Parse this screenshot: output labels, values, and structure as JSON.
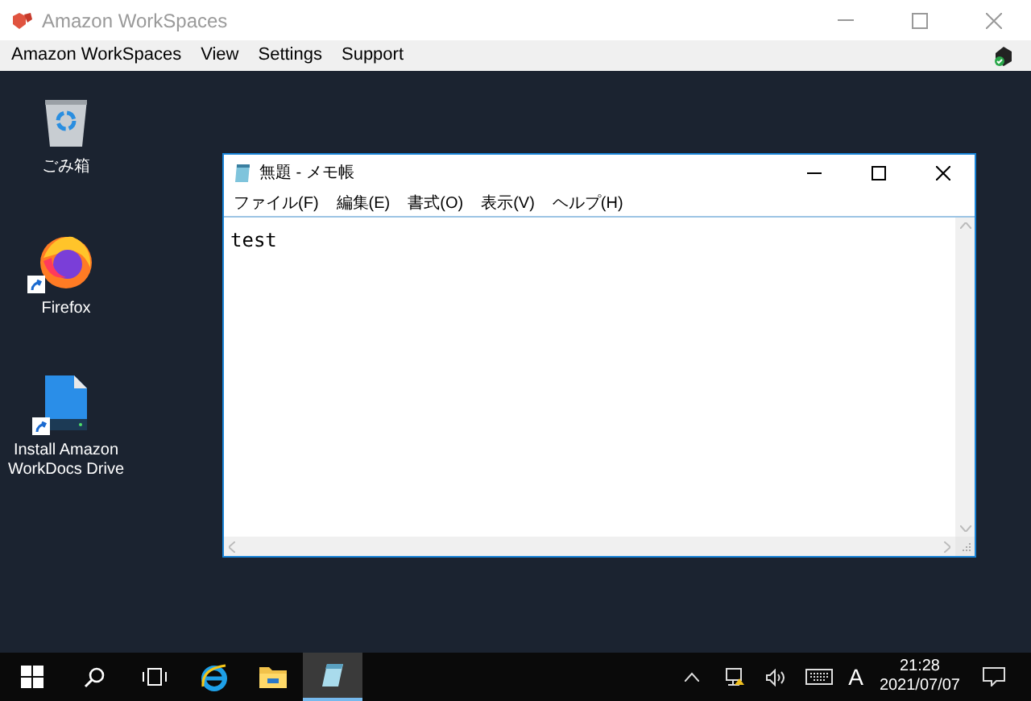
{
  "window": {
    "title": "Amazon WorkSpaces"
  },
  "menu": [
    "Amazon WorkSpaces",
    "View",
    "Settings",
    "Support"
  ],
  "desktop_icons": [
    {
      "kind": "recycle",
      "label": "ごみ箱",
      "shortcut": false
    },
    {
      "kind": "firefox",
      "label": "Firefox",
      "shortcut": true
    },
    {
      "kind": "workdocs",
      "label": "Install Amazon WorkDocs Drive",
      "shortcut": true
    }
  ],
  "notepad": {
    "title": "無題 - メモ帳",
    "menu": [
      "ファイル(F)",
      "編集(E)",
      "書式(O)",
      "表示(V)",
      "ヘルプ(H)"
    ],
    "text": "test"
  },
  "taskbar": {
    "items": [
      {
        "kind": "start",
        "selected": false
      },
      {
        "kind": "search",
        "selected": false
      },
      {
        "kind": "taskview",
        "selected": false
      },
      {
        "kind": "ie",
        "selected": false
      },
      {
        "kind": "explorer",
        "selected": false
      },
      {
        "kind": "notepad",
        "selected": true
      }
    ],
    "ime": "A",
    "time": "21:28",
    "date": "2021/07/07"
  }
}
